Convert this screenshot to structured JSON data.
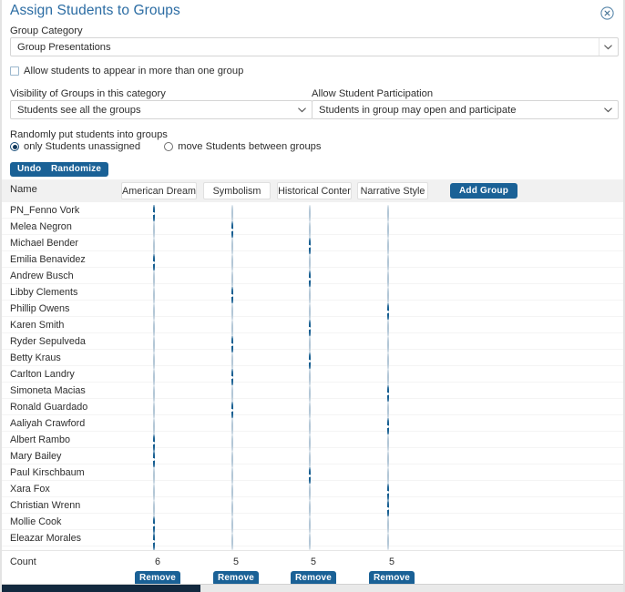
{
  "dialog": {
    "title": "Assign Students to Groups",
    "close_icon": "close-circle-icon"
  },
  "form": {
    "group_category_label": "Group Category",
    "group_category_value": "Group Presentations",
    "allow_multi_group_label": "Allow students to appear in more than one group",
    "allow_multi_group_checked": false,
    "visibility_label": "Visibility of Groups in this category",
    "visibility_value": "Students see all the groups",
    "participation_label": "Allow Student Participation",
    "participation_value": "Students in group may open and participate",
    "randomly_label": "Randomly put students into groups",
    "random_option_1": "only Students unassigned",
    "random_option_2": "move Students between groups",
    "random_selected": 1,
    "undo_label": "Undo",
    "randomize_label": "Randomize"
  },
  "table": {
    "name_header": "Name",
    "add_group_label": "Add Group",
    "count_label": "Count",
    "remove_label": "Remove",
    "groups": [
      "American Dream",
      "Symbolism",
      "Historical Conter",
      "Narrative Style"
    ],
    "counts": [
      6,
      5,
      5,
      5
    ],
    "students": [
      {
        "name": "PN_Fenno Vork",
        "group": 0
      },
      {
        "name": "Melea Negron",
        "group": 1
      },
      {
        "name": "Michael Bender",
        "group": 2
      },
      {
        "name": "Emilia Benavidez",
        "group": 0
      },
      {
        "name": "Andrew Busch",
        "group": 2
      },
      {
        "name": "Libby Clements",
        "group": 1
      },
      {
        "name": "Phillip Owens",
        "group": 3
      },
      {
        "name": "Karen Smith",
        "group": 2
      },
      {
        "name": "Ryder Sepulveda",
        "group": 1
      },
      {
        "name": "Betty Kraus",
        "group": 2
      },
      {
        "name": "Carlton Landry",
        "group": 1
      },
      {
        "name": "Simoneta Macias",
        "group": 3
      },
      {
        "name": "Ronald Guardado",
        "group": 1
      },
      {
        "name": "Aaliyah Crawford",
        "group": 3
      },
      {
        "name": "Albert Rambo",
        "group": 0
      },
      {
        "name": "Mary Bailey",
        "group": 0
      },
      {
        "name": "Paul Kirschbaum",
        "group": 2
      },
      {
        "name": "Xara Fox",
        "group": 3
      },
      {
        "name": "Christian Wrenn",
        "group": 3
      },
      {
        "name": "Mollie Cook",
        "group": 0
      },
      {
        "name": "Eleazar Morales",
        "group": 0
      }
    ]
  },
  "colors": {
    "accent": "#1a6196",
    "title": "#2b6ca3",
    "header_bg": "#f1f1f1",
    "scrollbar_thumb": "#13293f"
  }
}
